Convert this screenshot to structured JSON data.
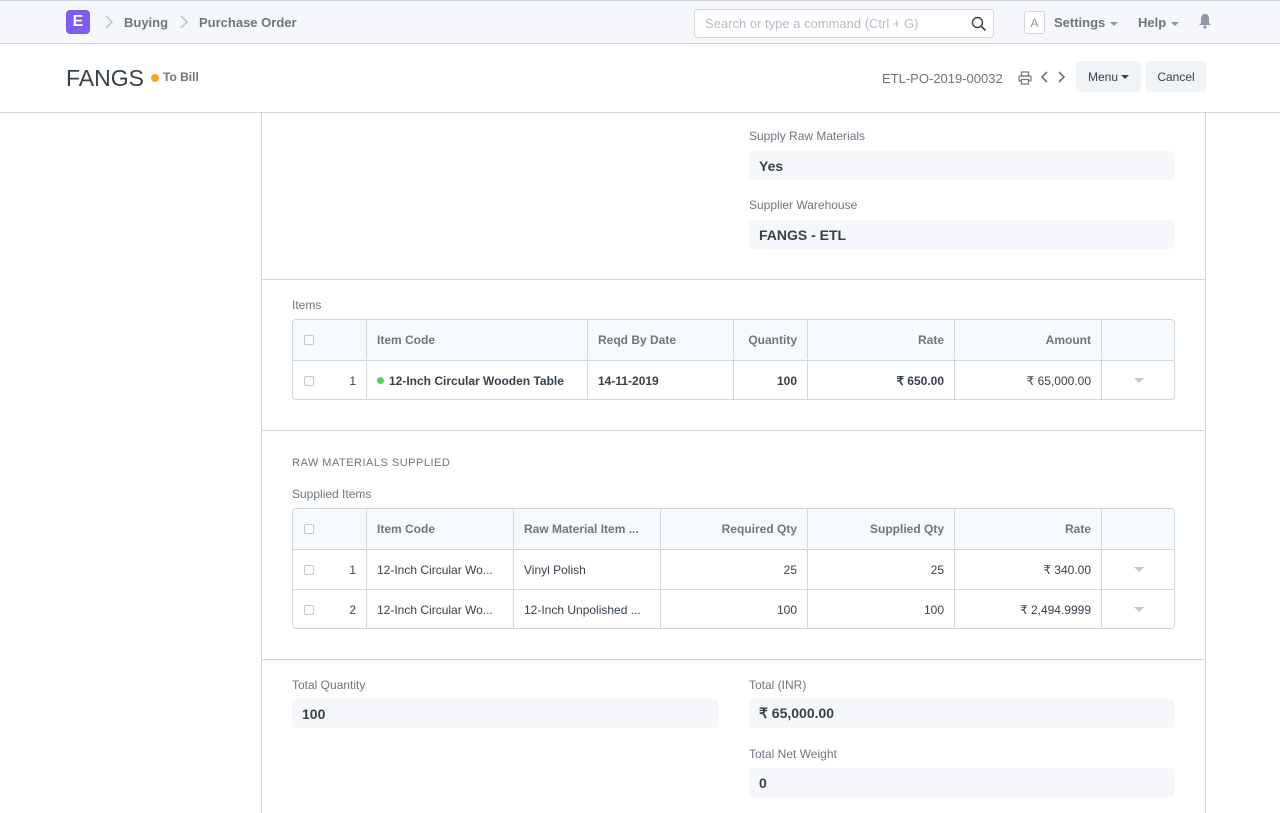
{
  "nav": {
    "logo": "E",
    "breadcrumbs": [
      "Buying",
      "Purchase Order"
    ],
    "search_placeholder": "Search or type a command (Ctrl + G)",
    "avatar": "A",
    "settings": "Settings",
    "help": "Help"
  },
  "header": {
    "title": "FANGS",
    "status": "To Bill",
    "status_color": "#f8a51f",
    "docname": "ETL-PO-2019-00032",
    "menu": "Menu",
    "cancel": "Cancel"
  },
  "supply": {
    "raw_label": "Supply Raw Materials",
    "raw_value": "Yes",
    "warehouse_label": "Supplier Warehouse",
    "warehouse_value": "FANGS - ETL"
  },
  "items": {
    "label": "Items",
    "columns": [
      "Item Code",
      "Reqd By Date",
      "Quantity",
      "Rate",
      "Amount"
    ],
    "rows": [
      {
        "no": "1",
        "item_code": "12-Inch Circular Wooden Table",
        "reqd_by": "14-11-2019",
        "qty": "100",
        "rate": "₹ 650.00",
        "amount": "₹ 65,000.00"
      }
    ]
  },
  "raw_materials": {
    "section": "RAW MATERIALS SUPPLIED",
    "label": "Supplied Items",
    "columns": [
      "Item Code",
      "Raw Material Item ...",
      "Required Qty",
      "Supplied Qty",
      "Rate"
    ],
    "rows": [
      {
        "no": "1",
        "item_code": "12-Inch Circular Wo...",
        "raw": "Vinyl Polish",
        "req": "25",
        "sup": "25",
        "rate": "₹ 340.00"
      },
      {
        "no": "2",
        "item_code": "12-Inch Circular Wo...",
        "raw": "12-Inch Unpolished ...",
        "req": "100",
        "sup": "100",
        "rate": "₹ 2,494.9999"
      }
    ]
  },
  "totals": {
    "total_qty_label": "Total Quantity",
    "total_qty": "100",
    "total_inr_label": "Total (INR)",
    "total_inr": "₹ 65,000.00",
    "net_weight_label": "Total Net Weight",
    "net_weight": "0"
  }
}
